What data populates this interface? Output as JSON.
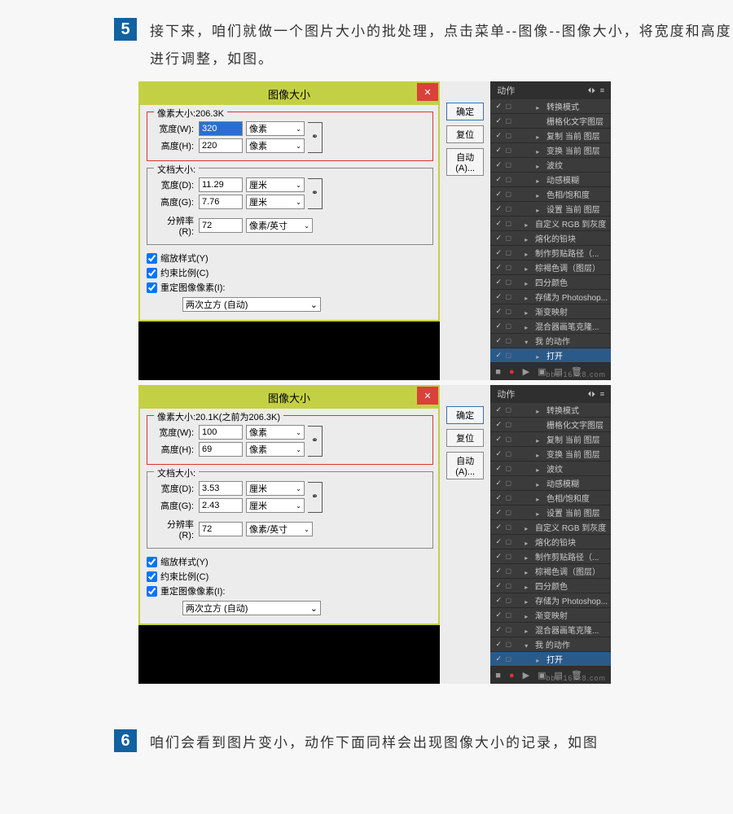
{
  "step5": {
    "num": "5",
    "text": "接下来，咱们就做一个图片大小的批处理，点击菜单--图像--图像大小，将宽度和高度进行调整，如图。"
  },
  "step6": {
    "num": "6",
    "text": "咱们会看到图片变小，动作下面同样会出现图像大小的记录，如图"
  },
  "dialog": {
    "title": "图像大小",
    "close": "✕",
    "pixel_label_a": "像素大小:206.3K",
    "pixel_label_b": "像素大小:20.1K(之前为206.3K)",
    "width_label": "宽度(W):",
    "height_label": "高度(H):",
    "doc_label": "文档大小:",
    "res_label": "分辨率(R):",
    "doc_width_label": "宽度(D):",
    "doc_height_label": "高度(G):",
    "unit_px": "像素",
    "unit_cm": "厘米",
    "unit_ppi": "像素/英寸",
    "link_icon": "⚭",
    "btn_ok": "确定",
    "btn_reset": "复位",
    "btn_auto": "自动(A)...",
    "chk_scale": "缩放样式(Y)",
    "chk_constrain": "约束比例(C)",
    "chk_resample": "重定图像像素(I):",
    "interp": "两次立方 (自动)",
    "arr": "⌄",
    "a": {
      "w": "320",
      "h": "220",
      "dw": "11.29",
      "dh": "7.76",
      "res": "72"
    },
    "b": {
      "w": "100",
      "h": "69",
      "dw": "3.53",
      "dh": "2.43",
      "res": "72"
    }
  },
  "actions": {
    "title": "动作",
    "menu": "≡",
    "tabs": "⏴⏵",
    "items": [
      {
        "label": "转换模式",
        "tri": "▸",
        "ind": 2
      },
      {
        "label": "栅格化文字图层",
        "tri": "",
        "ind": 2
      },
      {
        "label": "复制 当前 图层",
        "tri": "▸",
        "ind": 2
      },
      {
        "label": "变换 当前 图层",
        "tri": "▸",
        "ind": 2
      },
      {
        "label": "波纹",
        "tri": "▸",
        "ind": 2
      },
      {
        "label": "动感模糊",
        "tri": "▸",
        "ind": 2
      },
      {
        "label": "色相/饱和度",
        "tri": "▸",
        "ind": 2
      },
      {
        "label": "设置 当前 图层",
        "tri": "▸",
        "ind": 2
      },
      {
        "label": "自定义 RGB 到灰度",
        "tri": "▸",
        "ind": 1
      },
      {
        "label": "熔化的铅块",
        "tri": "▸",
        "ind": 1
      },
      {
        "label": "制作剪贴路径（...",
        "tri": "▸",
        "ind": 1
      },
      {
        "label": "棕褐色调（图层）",
        "tri": "▸",
        "ind": 1
      },
      {
        "label": "四分颜色",
        "tri": "▸",
        "ind": 1
      },
      {
        "label": "存储为 Photoshop...",
        "tri": "▸",
        "ind": 1
      },
      {
        "label": "渐变映射",
        "tri": "▸",
        "ind": 1
      },
      {
        "label": "混合器画笔克隆...",
        "tri": "▸",
        "ind": 1
      },
      {
        "label": "我 的动作",
        "tri": "▾",
        "ind": 1
      },
      {
        "label": "打开",
        "tri": "▸",
        "ind": 2,
        "hl": true
      }
    ],
    "check": "✓",
    "square": "▢",
    "foot": {
      "stop": "■",
      "rec": "●",
      "play": "▶",
      "folder": "▣",
      "new": "▤",
      "trash": "🗑"
    }
  },
  "watermark": "bbs.16xx8.com"
}
